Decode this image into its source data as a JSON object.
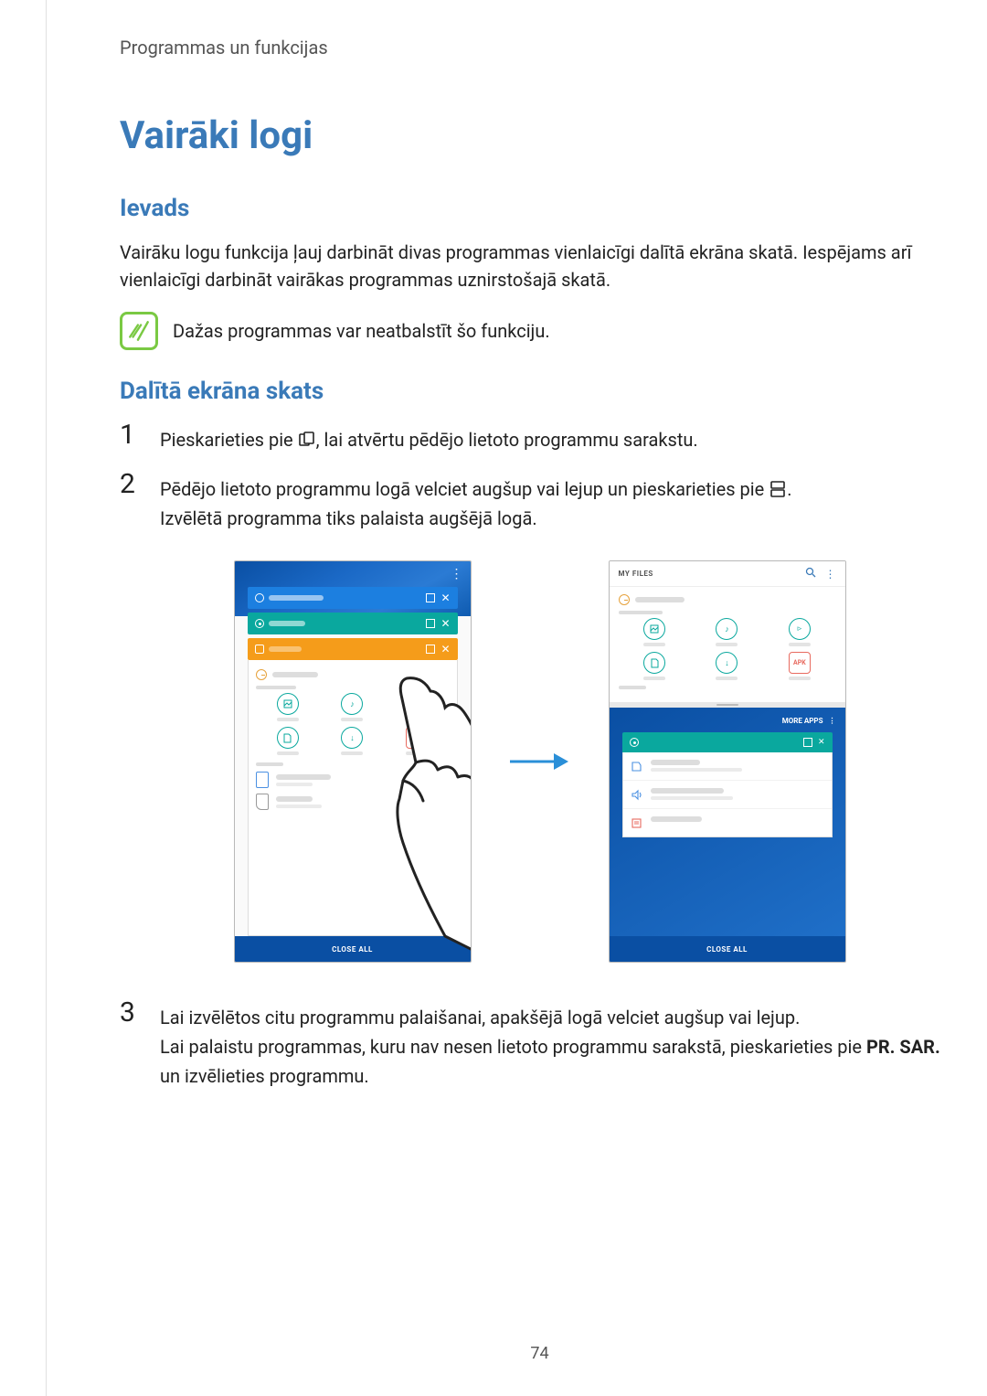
{
  "header": "Programmas un funkcijas",
  "title": "Vairāki logi",
  "section1": {
    "heading": "Ievads",
    "paragraph": "Vairāku logu funkcija ļauj darbināt divas programmas vienlaicīgi dalītā ekrāna skatā. Iespējams arī vienlaicīgi darbināt vairākas programmas uznirstošajā skatā.",
    "note": "Dažas programmas var neatbalstīt šo funkciju."
  },
  "section2": {
    "heading": "Dalītā ekrāna skats",
    "steps": [
      {
        "n": "1",
        "pre": "Pieskarieties pie ",
        "post": ", lai atvērtu pēdējo lietoto programmu sarakstu."
      },
      {
        "n": "2",
        "pre": "Pēdējo lietoto programmu logā velciet augšup vai lejup un pieskarieties pie ",
        "post": ".",
        "line2": "Izvēlētā programma tiks palaista augšējā logā."
      },
      {
        "n": "3",
        "line1": "Lai izvēlētos citu programmu palaišanai, apakšējā logā velciet augšup vai lejup.",
        "line2a": "Lai palaistu programmas, kuru nav nesen lietoto programmu sarakstā, pieskarieties pie ",
        "bold1": "PR. SAR.",
        "line2b": " un izvēlieties programmu."
      }
    ]
  },
  "illus": {
    "myfiles": "MY FILES",
    "closeall": "CLOSE ALL",
    "moreapps": "MORE APPS",
    "apk": "APK"
  },
  "page_number": "74"
}
